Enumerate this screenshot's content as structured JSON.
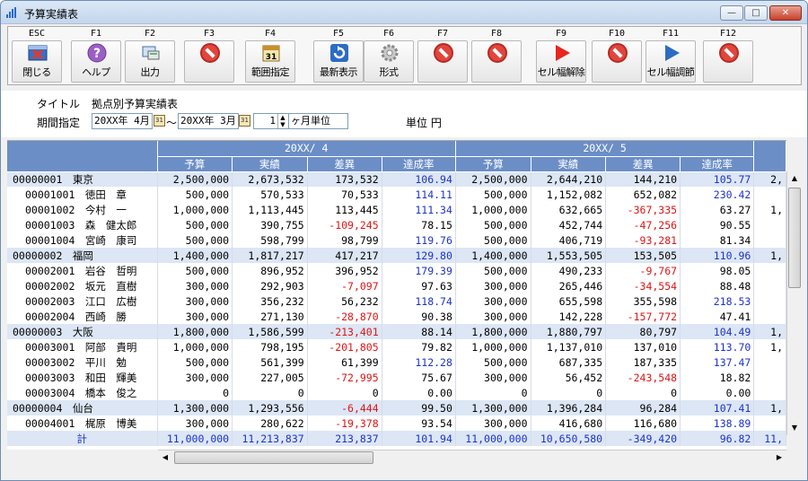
{
  "window": {
    "title": "予算実績表",
    "min_label": "—",
    "max_label": "□",
    "close_label": "✕"
  },
  "toolbar": [
    {
      "key": "ESC",
      "label": "閉じる",
      "icon": "close-window-icon"
    },
    {
      "key": "F1",
      "label": "ヘルプ",
      "icon": "help-icon"
    },
    {
      "key": "F2",
      "label": "出力",
      "icon": "print-output-icon"
    },
    {
      "key": "F3",
      "label": "",
      "icon": "disabled-icon"
    },
    {
      "key": "F4",
      "label": "範囲指定",
      "icon": "calendar-icon"
    },
    {
      "key": "F5",
      "label": "最新表示",
      "icon": "refresh-icon"
    },
    {
      "key": "F6",
      "label": "形式",
      "icon": "gear-icon"
    },
    {
      "key": "F7",
      "label": "",
      "icon": "disabled-icon"
    },
    {
      "key": "F8",
      "label": "",
      "icon": "disabled-icon"
    },
    {
      "key": "F9",
      "label": "セル幅解除",
      "icon": "play-red-icon"
    },
    {
      "key": "F10",
      "label": "",
      "icon": "disabled-icon"
    },
    {
      "key": "F11",
      "label": "セル幅調節",
      "icon": "play-blue-icon"
    },
    {
      "key": "F12",
      "label": "",
      "icon": "disabled-icon"
    }
  ],
  "form": {
    "title_label": "タイトル",
    "title_value": "拠点別予算実績表",
    "period_label": "期間指定",
    "period_from": "20XX年 4月",
    "period_sep": "～",
    "period_to": "20XX年 3月",
    "unit_months": "1",
    "unit_months_suffix": "ヶ月単位",
    "unit_label": "単位 円",
    "calendar_glyph": "31"
  },
  "grid": {
    "months": [
      "20XX/ 4",
      "20XX/ 5"
    ],
    "sub_headers": [
      "予算",
      "実績",
      "差異",
      "達成率"
    ],
    "rows": [
      {
        "level": 1,
        "code": "00000001",
        "name": "東京",
        "v": [
          "2,500,000",
          "2,673,532",
          "173,532",
          "106.94",
          "2,500,000",
          "2,644,210",
          "144,210",
          "105.77"
        ],
        "neg": [
          false,
          false
        ],
        "rate_blue": [
          true,
          true
        ],
        "extra": "2,"
      },
      {
        "level": 2,
        "code": "00001001",
        "name": "徳田　章",
        "v": [
          "500,000",
          "570,533",
          "70,533",
          "114.11",
          "500,000",
          "1,152,082",
          "652,082",
          "230.42"
        ],
        "neg": [
          false,
          false
        ],
        "rate_blue": [
          true,
          true
        ],
        "extra": ""
      },
      {
        "level": 2,
        "code": "00001002",
        "name": "今村　一",
        "v": [
          "1,000,000",
          "1,113,445",
          "113,445",
          "111.34",
          "1,000,000",
          "632,665",
          "-367,335",
          "63.27"
        ],
        "neg": [
          false,
          true
        ],
        "rate_blue": [
          true,
          false
        ],
        "extra": "1,"
      },
      {
        "level": 2,
        "code": "00001003",
        "name": "森　健太郎",
        "v": [
          "500,000",
          "390,755",
          "-109,245",
          "78.15",
          "500,000",
          "452,744",
          "-47,256",
          "90.55"
        ],
        "neg": [
          true,
          true
        ],
        "rate_blue": [
          false,
          false
        ],
        "extra": ""
      },
      {
        "level": 2,
        "code": "00001004",
        "name": "宮崎　康司",
        "v": [
          "500,000",
          "598,799",
          "98,799",
          "119.76",
          "500,000",
          "406,719",
          "-93,281",
          "81.34"
        ],
        "neg": [
          false,
          true
        ],
        "rate_blue": [
          true,
          false
        ],
        "extra": ""
      },
      {
        "level": 1,
        "code": "00000002",
        "name": "福岡",
        "v": [
          "1,400,000",
          "1,817,217",
          "417,217",
          "129.80",
          "1,400,000",
          "1,553,505",
          "153,505",
          "110.96"
        ],
        "neg": [
          false,
          false
        ],
        "rate_blue": [
          true,
          true
        ],
        "extra": "1,"
      },
      {
        "level": 2,
        "code": "00002001",
        "name": "岩谷　哲明",
        "v": [
          "500,000",
          "896,952",
          "396,952",
          "179.39",
          "500,000",
          "490,233",
          "-9,767",
          "98.05"
        ],
        "neg": [
          false,
          true
        ],
        "rate_blue": [
          true,
          false
        ],
        "extra": ""
      },
      {
        "level": 2,
        "code": "00002002",
        "name": "坂元　直樹",
        "v": [
          "300,000",
          "292,903",
          "-7,097",
          "97.63",
          "300,000",
          "265,446",
          "-34,554",
          "88.48"
        ],
        "neg": [
          true,
          true
        ],
        "rate_blue": [
          false,
          false
        ],
        "extra": ""
      },
      {
        "level": 2,
        "code": "00002003",
        "name": "江口　広樹",
        "v": [
          "300,000",
          "356,232",
          "56,232",
          "118.74",
          "300,000",
          "655,598",
          "355,598",
          "218.53"
        ],
        "neg": [
          false,
          false
        ],
        "rate_blue": [
          true,
          true
        ],
        "extra": ""
      },
      {
        "level": 2,
        "code": "00002004",
        "name": "西崎　勝",
        "v": [
          "300,000",
          "271,130",
          "-28,870",
          "90.38",
          "300,000",
          "142,228",
          "-157,772",
          "47.41"
        ],
        "neg": [
          true,
          true
        ],
        "rate_blue": [
          false,
          false
        ],
        "extra": ""
      },
      {
        "level": 1,
        "code": "00000003",
        "name": "大阪",
        "v": [
          "1,800,000",
          "1,586,599",
          "-213,401",
          "88.14",
          "1,800,000",
          "1,880,797",
          "80,797",
          "104.49"
        ],
        "neg": [
          true,
          false
        ],
        "rate_blue": [
          false,
          true
        ],
        "extra": "1,"
      },
      {
        "level": 2,
        "code": "00003001",
        "name": "阿部　貴明",
        "v": [
          "1,000,000",
          "798,195",
          "-201,805",
          "79.82",
          "1,000,000",
          "1,137,010",
          "137,010",
          "113.70"
        ],
        "neg": [
          true,
          false
        ],
        "rate_blue": [
          false,
          true
        ],
        "extra": "1,"
      },
      {
        "level": 2,
        "code": "00003002",
        "name": "平川　勉",
        "v": [
          "500,000",
          "561,399",
          "61,399",
          "112.28",
          "500,000",
          "687,335",
          "187,335",
          "137.47"
        ],
        "neg": [
          false,
          false
        ],
        "rate_blue": [
          true,
          true
        ],
        "extra": ""
      },
      {
        "level": 2,
        "code": "00003003",
        "name": "和田　輝美",
        "v": [
          "300,000",
          "227,005",
          "-72,995",
          "75.67",
          "300,000",
          "56,452",
          "-243,548",
          "18.82"
        ],
        "neg": [
          true,
          true
        ],
        "rate_blue": [
          false,
          false
        ],
        "extra": ""
      },
      {
        "level": 2,
        "code": "00003004",
        "name": "橋本　俊之",
        "v": [
          "0",
          "0",
          "0",
          "0.00",
          "0",
          "0",
          "0",
          "0.00"
        ],
        "neg": [
          false,
          false
        ],
        "rate_blue": [
          false,
          false
        ],
        "extra": ""
      },
      {
        "level": 1,
        "code": "00000004",
        "name": "仙台",
        "v": [
          "1,300,000",
          "1,293,556",
          "-6,444",
          "99.50",
          "1,300,000",
          "1,396,284",
          "96,284",
          "107.41"
        ],
        "neg": [
          true,
          false
        ],
        "rate_blue": [
          false,
          true
        ],
        "extra": "1,"
      },
      {
        "level": 2,
        "code": "00004001",
        "name": "梶原　博美",
        "v": [
          "300,000",
          "280,622",
          "-19,378",
          "93.54",
          "300,000",
          "416,680",
          "116,680",
          "138.89"
        ],
        "neg": [
          true,
          false
        ],
        "rate_blue": [
          false,
          true
        ],
        "extra": ""
      }
    ],
    "total": {
      "label": "計",
      "v": [
        "11,000,000",
        "11,213,837",
        "213,837",
        "101.94",
        "11,000,000",
        "10,650,580",
        "-349,420",
        "96.82"
      ],
      "neg": [
        false,
        true
      ],
      "extra": "11,"
    }
  },
  "colors": {
    "header_blue": "#6b8ec7",
    "group_row": "#dce6f5",
    "negative": "#e01414",
    "rate": "#1d33c7"
  }
}
